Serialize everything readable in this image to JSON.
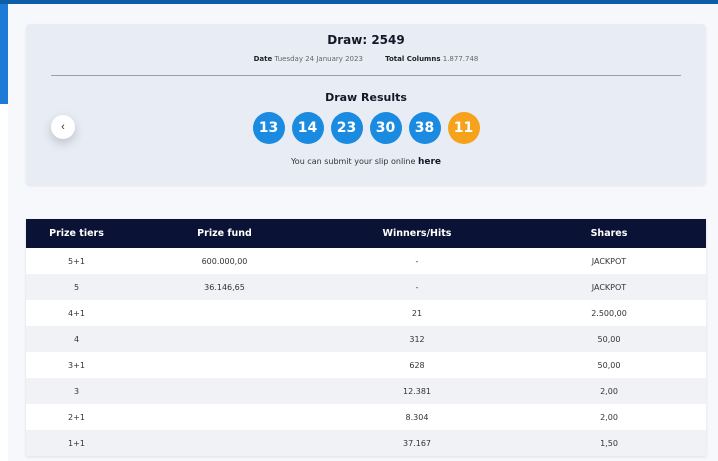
{
  "draw": {
    "title": "Draw: 2549",
    "date_label": "Date",
    "date_value": "Tuesday 24 January 2023",
    "columns_label": "Total Columns",
    "columns_value": "1.877.748",
    "results_title": "Draw Results",
    "numbers": [
      "13",
      "14",
      "23",
      "30",
      "38"
    ],
    "joker": "11",
    "submit_text": "You can submit your slip online",
    "submit_link": "here",
    "prev_icon": "‹"
  },
  "colors": {
    "ball": "#1a8be0",
    "joker": "#f6a21a",
    "header": "#0a1335"
  },
  "table": {
    "headers": [
      "Prize tiers",
      "Prize fund",
      "Winners/Hits",
      "Shares"
    ],
    "rows": [
      [
        "5+1",
        "600.000,00",
        "-",
        "JACKPOT"
      ],
      [
        "5",
        "36.146,65",
        "-",
        "JACKPOT"
      ],
      [
        "4+1",
        "",
        "21",
        "2.500,00"
      ],
      [
        "4",
        "",
        "312",
        "50,00"
      ],
      [
        "3+1",
        "",
        "628",
        "50,00"
      ],
      [
        "3",
        "",
        "12.381",
        "2,00"
      ],
      [
        "2+1",
        "",
        "8.304",
        "2,00"
      ],
      [
        "1+1",
        "",
        "37.167",
        "1,50"
      ]
    ]
  }
}
